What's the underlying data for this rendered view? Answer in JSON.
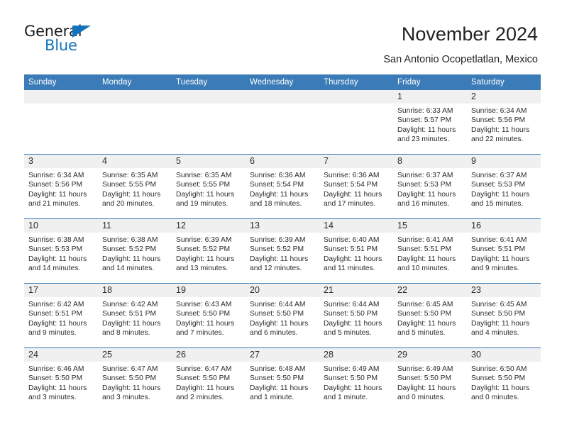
{
  "brand": {
    "name_part1": "General",
    "name_part2": "Blue",
    "triangle_color": "#1273bd",
    "text_color": "#1b1b1b"
  },
  "header": {
    "title": "November 2024",
    "subtitle": "San Antonio Ocopetlatlan, Mexico"
  },
  "theme": {
    "header_bg": "#3b7cb8",
    "header_text": "#ffffff",
    "daynum_bg": "#f0f0f0",
    "rule_color": "#3b7cb8",
    "body_text": "#2b2b2b"
  },
  "weekdays": [
    "Sunday",
    "Monday",
    "Tuesday",
    "Wednesday",
    "Thursday",
    "Friday",
    "Saturday"
  ],
  "labels": {
    "sunrise_prefix": "Sunrise:",
    "sunset_prefix": "Sunset:",
    "daylight_prefix": "Daylight:"
  },
  "weeks": [
    [
      {
        "day": "",
        "empty": true
      },
      {
        "day": "",
        "empty": true
      },
      {
        "day": "",
        "empty": true
      },
      {
        "day": "",
        "empty": true
      },
      {
        "day": "",
        "empty": true
      },
      {
        "day": "1",
        "sunrise": "Sunrise: 6:33 AM",
        "sunset": "Sunset: 5:57 PM",
        "daylight_line1": "Daylight: 11 hours",
        "daylight_line2": "and 23 minutes."
      },
      {
        "day": "2",
        "sunrise": "Sunrise: 6:34 AM",
        "sunset": "Sunset: 5:56 PM",
        "daylight_line1": "Daylight: 11 hours",
        "daylight_line2": "and 22 minutes."
      }
    ],
    [
      {
        "day": "3",
        "sunrise": "Sunrise: 6:34 AM",
        "sunset": "Sunset: 5:56 PM",
        "daylight_line1": "Daylight: 11 hours",
        "daylight_line2": "and 21 minutes."
      },
      {
        "day": "4",
        "sunrise": "Sunrise: 6:35 AM",
        "sunset": "Sunset: 5:55 PM",
        "daylight_line1": "Daylight: 11 hours",
        "daylight_line2": "and 20 minutes."
      },
      {
        "day": "5",
        "sunrise": "Sunrise: 6:35 AM",
        "sunset": "Sunset: 5:55 PM",
        "daylight_line1": "Daylight: 11 hours",
        "daylight_line2": "and 19 minutes."
      },
      {
        "day": "6",
        "sunrise": "Sunrise: 6:36 AM",
        "sunset": "Sunset: 5:54 PM",
        "daylight_line1": "Daylight: 11 hours",
        "daylight_line2": "and 18 minutes."
      },
      {
        "day": "7",
        "sunrise": "Sunrise: 6:36 AM",
        "sunset": "Sunset: 5:54 PM",
        "daylight_line1": "Daylight: 11 hours",
        "daylight_line2": "and 17 minutes."
      },
      {
        "day": "8",
        "sunrise": "Sunrise: 6:37 AM",
        "sunset": "Sunset: 5:53 PM",
        "daylight_line1": "Daylight: 11 hours",
        "daylight_line2": "and 16 minutes."
      },
      {
        "day": "9",
        "sunrise": "Sunrise: 6:37 AM",
        "sunset": "Sunset: 5:53 PM",
        "daylight_line1": "Daylight: 11 hours",
        "daylight_line2": "and 15 minutes."
      }
    ],
    [
      {
        "day": "10",
        "sunrise": "Sunrise: 6:38 AM",
        "sunset": "Sunset: 5:53 PM",
        "daylight_line1": "Daylight: 11 hours",
        "daylight_line2": "and 14 minutes."
      },
      {
        "day": "11",
        "sunrise": "Sunrise: 6:38 AM",
        "sunset": "Sunset: 5:52 PM",
        "daylight_line1": "Daylight: 11 hours",
        "daylight_line2": "and 14 minutes."
      },
      {
        "day": "12",
        "sunrise": "Sunrise: 6:39 AM",
        "sunset": "Sunset: 5:52 PM",
        "daylight_line1": "Daylight: 11 hours",
        "daylight_line2": "and 13 minutes."
      },
      {
        "day": "13",
        "sunrise": "Sunrise: 6:39 AM",
        "sunset": "Sunset: 5:52 PM",
        "daylight_line1": "Daylight: 11 hours",
        "daylight_line2": "and 12 minutes."
      },
      {
        "day": "14",
        "sunrise": "Sunrise: 6:40 AM",
        "sunset": "Sunset: 5:51 PM",
        "daylight_line1": "Daylight: 11 hours",
        "daylight_line2": "and 11 minutes."
      },
      {
        "day": "15",
        "sunrise": "Sunrise: 6:41 AM",
        "sunset": "Sunset: 5:51 PM",
        "daylight_line1": "Daylight: 11 hours",
        "daylight_line2": "and 10 minutes."
      },
      {
        "day": "16",
        "sunrise": "Sunrise: 6:41 AM",
        "sunset": "Sunset: 5:51 PM",
        "daylight_line1": "Daylight: 11 hours",
        "daylight_line2": "and 9 minutes."
      }
    ],
    [
      {
        "day": "17",
        "sunrise": "Sunrise: 6:42 AM",
        "sunset": "Sunset: 5:51 PM",
        "daylight_line1": "Daylight: 11 hours",
        "daylight_line2": "and 9 minutes."
      },
      {
        "day": "18",
        "sunrise": "Sunrise: 6:42 AM",
        "sunset": "Sunset: 5:51 PM",
        "daylight_line1": "Daylight: 11 hours",
        "daylight_line2": "and 8 minutes."
      },
      {
        "day": "19",
        "sunrise": "Sunrise: 6:43 AM",
        "sunset": "Sunset: 5:50 PM",
        "daylight_line1": "Daylight: 11 hours",
        "daylight_line2": "and 7 minutes."
      },
      {
        "day": "20",
        "sunrise": "Sunrise: 6:44 AM",
        "sunset": "Sunset: 5:50 PM",
        "daylight_line1": "Daylight: 11 hours",
        "daylight_line2": "and 6 minutes."
      },
      {
        "day": "21",
        "sunrise": "Sunrise: 6:44 AM",
        "sunset": "Sunset: 5:50 PM",
        "daylight_line1": "Daylight: 11 hours",
        "daylight_line2": "and 5 minutes."
      },
      {
        "day": "22",
        "sunrise": "Sunrise: 6:45 AM",
        "sunset": "Sunset: 5:50 PM",
        "daylight_line1": "Daylight: 11 hours",
        "daylight_line2": "and 5 minutes."
      },
      {
        "day": "23",
        "sunrise": "Sunrise: 6:45 AM",
        "sunset": "Sunset: 5:50 PM",
        "daylight_line1": "Daylight: 11 hours",
        "daylight_line2": "and 4 minutes."
      }
    ],
    [
      {
        "day": "24",
        "sunrise": "Sunrise: 6:46 AM",
        "sunset": "Sunset: 5:50 PM",
        "daylight_line1": "Daylight: 11 hours",
        "daylight_line2": "and 3 minutes."
      },
      {
        "day": "25",
        "sunrise": "Sunrise: 6:47 AM",
        "sunset": "Sunset: 5:50 PM",
        "daylight_line1": "Daylight: 11 hours",
        "daylight_line2": "and 3 minutes."
      },
      {
        "day": "26",
        "sunrise": "Sunrise: 6:47 AM",
        "sunset": "Sunset: 5:50 PM",
        "daylight_line1": "Daylight: 11 hours",
        "daylight_line2": "and 2 minutes."
      },
      {
        "day": "27",
        "sunrise": "Sunrise: 6:48 AM",
        "sunset": "Sunset: 5:50 PM",
        "daylight_line1": "Daylight: 11 hours",
        "daylight_line2": "and 1 minute."
      },
      {
        "day": "28",
        "sunrise": "Sunrise: 6:49 AM",
        "sunset": "Sunset: 5:50 PM",
        "daylight_line1": "Daylight: 11 hours",
        "daylight_line2": "and 1 minute."
      },
      {
        "day": "29",
        "sunrise": "Sunrise: 6:49 AM",
        "sunset": "Sunset: 5:50 PM",
        "daylight_line1": "Daylight: 11 hours",
        "daylight_line2": "and 0 minutes."
      },
      {
        "day": "30",
        "sunrise": "Sunrise: 6:50 AM",
        "sunset": "Sunset: 5:50 PM",
        "daylight_line1": "Daylight: 11 hours",
        "daylight_line2": "and 0 minutes."
      }
    ]
  ]
}
